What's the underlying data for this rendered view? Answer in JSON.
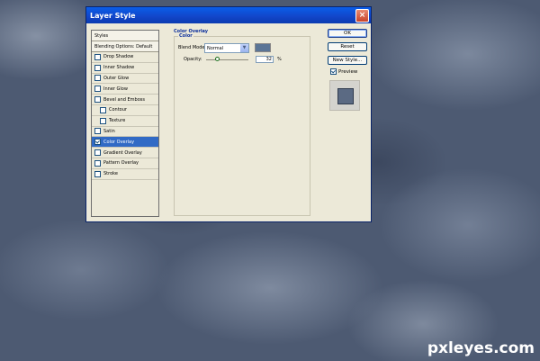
{
  "window": {
    "title": "Layer Style",
    "close_glyph": "×"
  },
  "styles_list": {
    "items": [
      {
        "label": "Styles",
        "type": "header"
      },
      {
        "label": "Blending Options: Default",
        "type": "header"
      },
      {
        "label": "Drop Shadow",
        "checked": false
      },
      {
        "label": "Inner Shadow",
        "checked": false
      },
      {
        "label": "Outer Glow",
        "checked": false
      },
      {
        "label": "Inner Glow",
        "checked": false
      },
      {
        "label": "Bevel and Emboss",
        "checked": false
      },
      {
        "label": "Contour",
        "checked": false,
        "sub": true
      },
      {
        "label": "Texture",
        "checked": false,
        "sub": true
      },
      {
        "label": "Satin",
        "checked": false
      },
      {
        "label": "Color Overlay",
        "checked": true,
        "selected": true
      },
      {
        "label": "Gradient Overlay",
        "checked": false
      },
      {
        "label": "Pattern Overlay",
        "checked": false
      },
      {
        "label": "Stroke",
        "checked": false
      }
    ]
  },
  "panel": {
    "section_title": "Color Overlay",
    "group_title": "Color",
    "blend_mode_label": "Blend Mode:",
    "blend_mode_value": "Normal",
    "overlay_color": "#5b7596",
    "opacity_label": "Opacity:",
    "opacity_value": "32",
    "opacity_unit": "%"
  },
  "buttons": {
    "ok": "OK",
    "reset": "Reset",
    "new_style": "New Style...",
    "preview_label": "Preview",
    "preview_checked": true
  },
  "watermark": "pxleyes.com"
}
